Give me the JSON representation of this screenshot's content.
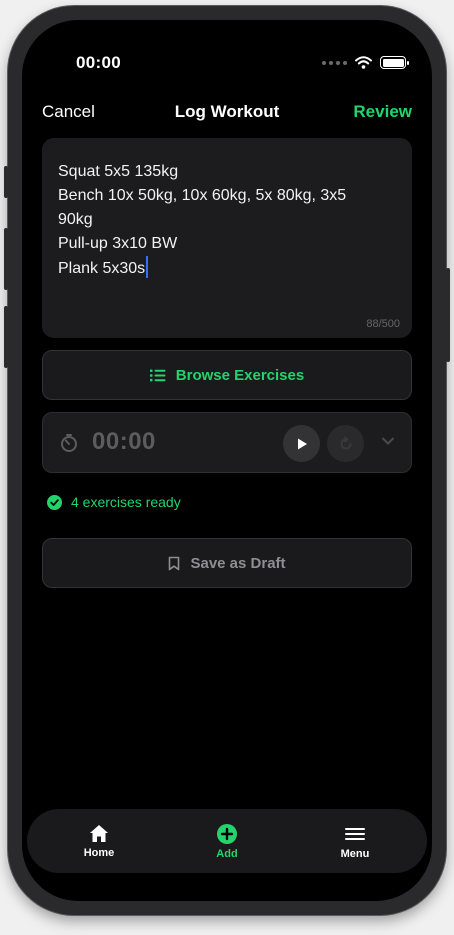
{
  "status_bar": {
    "time": "00:00"
  },
  "nav": {
    "cancel": "Cancel",
    "title": "Log Workout",
    "review": "Review"
  },
  "editor": {
    "lines": [
      "Squat 5x5 135kg",
      "Bench 10x 50kg, 10x 60kg, 5x 80kg, 3x5",
      "90kg",
      "Pull-up 3x10 BW",
      "Plank 5x30s"
    ],
    "counter": "88/500"
  },
  "browse": {
    "label": "Browse Exercises",
    "icon": "list-icon"
  },
  "timer": {
    "time": "00:00",
    "icons": [
      "stopwatch-icon",
      "play-icon",
      "reset-icon",
      "chevron-down-icon"
    ]
  },
  "status": {
    "ready_text": "4 exercises ready",
    "icon": "check-circle-icon"
  },
  "draft": {
    "label": "Save as Draft",
    "icon": "bookmark-icon"
  },
  "tabbar": {
    "items": [
      {
        "label": "Home",
        "icon": "home-icon"
      },
      {
        "label": "Add",
        "icon": "plus-circle-icon"
      },
      {
        "label": "Menu",
        "icon": "hamburger-icon"
      }
    ]
  },
  "colors": {
    "accent": "#22d46b",
    "background": "#000000",
    "card": "#1c1c1e",
    "cursor": "#3b6cff"
  }
}
